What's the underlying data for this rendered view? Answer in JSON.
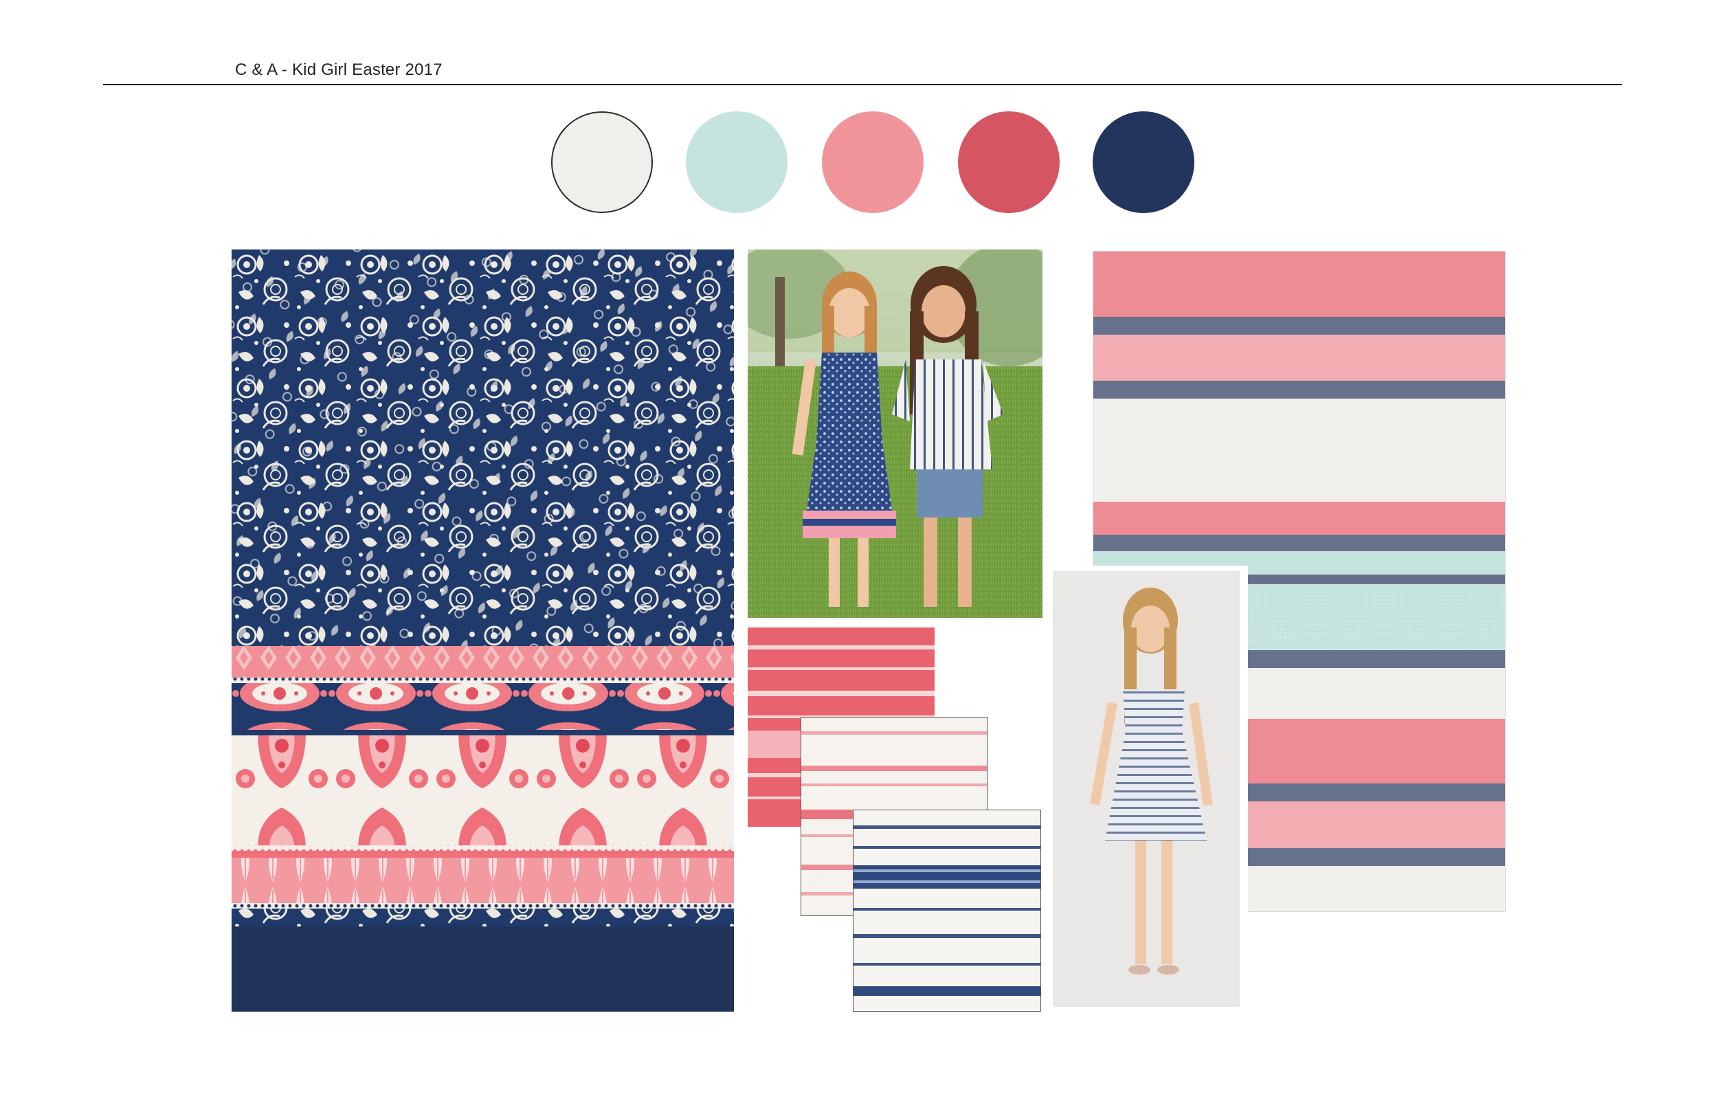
{
  "header": {
    "title": "C & A - Kid Girl Easter 2017"
  },
  "palette": {
    "colors": [
      "#f0efeb",
      "#c6e4df",
      "#f19499",
      "#d55562",
      "#22355c"
    ]
  },
  "boards": {
    "print_board": "floral-lace-and-paisley-border-print",
    "photo_two_girls": "two-girls-garden-photo",
    "photo_girl_dress": "girl-striped-dress-photo",
    "stripe_board": "coral-navy-stripe-print"
  },
  "fabrics": {
    "swatch_coral": "coral-stripe-fabric",
    "swatch_pink": "pink-on-white-stripe-fabric",
    "swatch_navy": "navy-on-white-stripe-fabric"
  }
}
